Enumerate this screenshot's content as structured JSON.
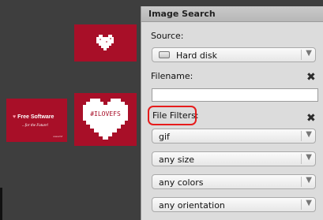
{
  "panel": {
    "title": "Image Search",
    "source_label": "Source:",
    "source_value": "Hard disk",
    "source_icon": "hard-disk-icon",
    "filename_label": "Filename:",
    "filename_value": "",
    "file_filters_label": "File Filters:",
    "filters": [
      {
        "value": "gif"
      },
      {
        "value": "any size"
      },
      {
        "value": "any colors"
      },
      {
        "value": "any orientation"
      }
    ],
    "clear_icon": "close-icon",
    "dropdown_icon": "chevron-down-icon"
  },
  "thumbnails": {
    "free_software": {
      "title": "Free Software",
      "subtitle": "...for the Future!",
      "small_print": "www.fsf"
    },
    "heart_big": {
      "label": "#ILOVEFS"
    }
  },
  "colors": {
    "thumbnail_red": "#a80f28",
    "highlight": "#e61c1c",
    "panel_bg": "#dcdcdc",
    "canvas_bg": "#3e3e3e"
  }
}
